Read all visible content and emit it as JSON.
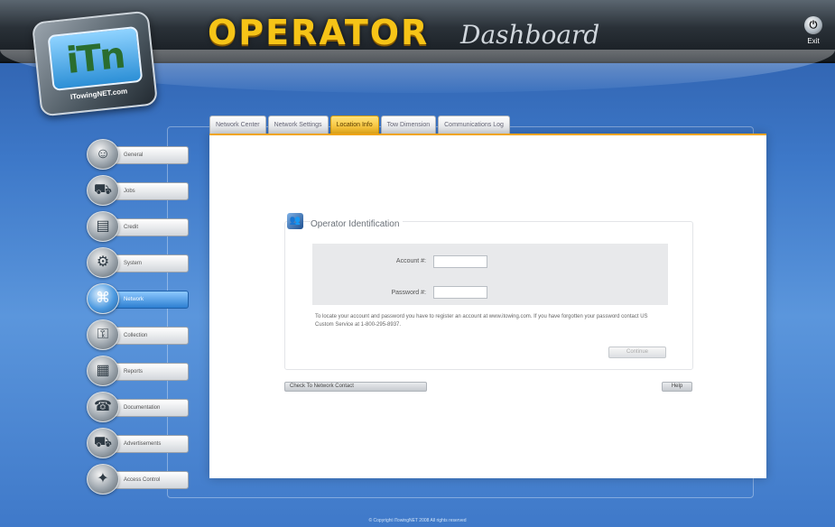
{
  "header": {
    "logo_text": "ITowingNET.com",
    "title": "OPERATOR",
    "subtitle": "Dashboard",
    "exit_label": "Exit"
  },
  "tabs": [
    {
      "label": "Network Center",
      "active": false
    },
    {
      "label": "Network Settings",
      "active": false
    },
    {
      "label": "Location Info",
      "active": true
    },
    {
      "label": "Tow Dimension",
      "active": false
    },
    {
      "label": "Communications Log",
      "active": false
    }
  ],
  "nav": [
    {
      "label": "General",
      "icon": "person-icon",
      "glyph": "☺",
      "active": false
    },
    {
      "label": "Jobs",
      "icon": "car-icon",
      "glyph": "⛟",
      "active": false
    },
    {
      "label": "Credit",
      "icon": "credit-icon",
      "glyph": "▤",
      "active": false
    },
    {
      "label": "System",
      "icon": "system-icon",
      "glyph": "⚙",
      "active": false
    },
    {
      "label": "Network",
      "icon": "network-icon",
      "glyph": "⌘",
      "active": true
    },
    {
      "label": "Collection",
      "icon": "lock-icon",
      "glyph": "⚿",
      "active": false
    },
    {
      "label": "Reports",
      "icon": "reports-icon",
      "glyph": "▦",
      "active": false
    },
    {
      "label": "Documentation",
      "icon": "phone-icon",
      "glyph": "☎",
      "active": false
    },
    {
      "label": "Advertisements",
      "icon": "truck-icon",
      "glyph": "⛟",
      "active": false
    },
    {
      "label": "Access Control",
      "icon": "access-icon",
      "glyph": "✦",
      "active": false
    }
  ],
  "login": {
    "group_title": "Operator Identification",
    "account_label": "Account #:",
    "account_value": "",
    "password_label": "Password #:",
    "password_value": "",
    "help_text": "To locate your account and password you have to register an account at www.itowing.com. If you have forgotten your password contact US Custom Service at 1-800-295-8937.",
    "continue_label": "Continue",
    "forgot_label": "Check To Network Contact",
    "help_label": "Help"
  },
  "footer": {
    "text": "© Copyright iTowingNET 2008 All rights reserved"
  },
  "colors": {
    "accent": "#f6c417",
    "active_tab": "#f4b51c",
    "background": "#3d78c8"
  }
}
